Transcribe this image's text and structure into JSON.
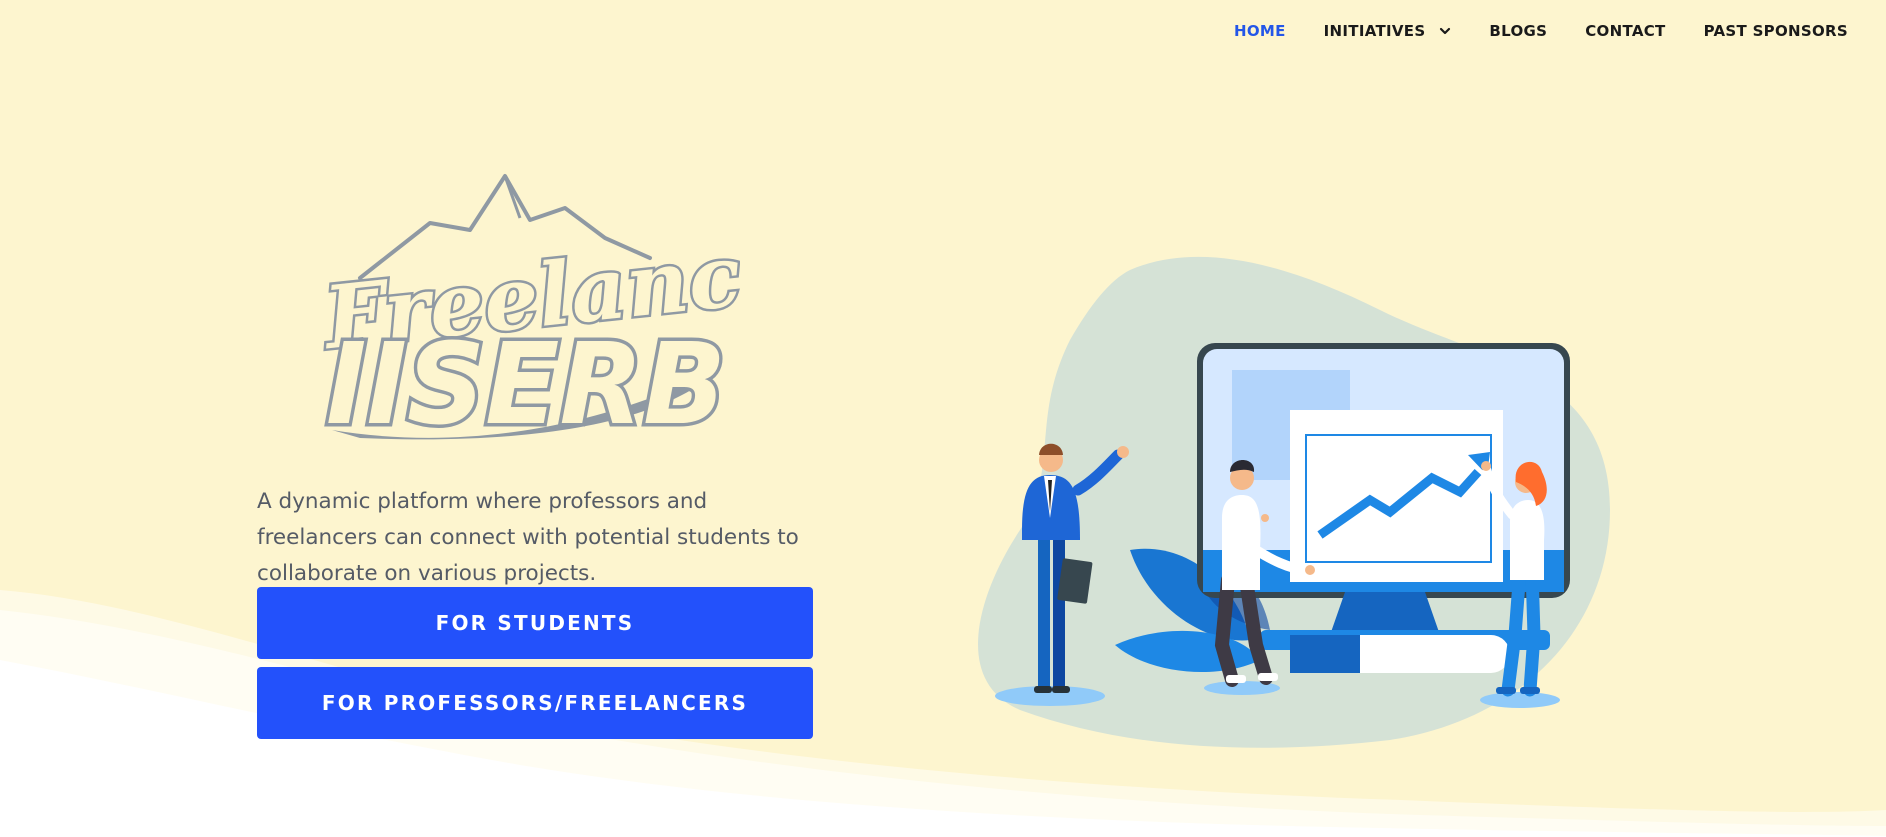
{
  "nav": {
    "items": [
      {
        "label": "HOME",
        "active": true
      },
      {
        "label": "INITIATIVES",
        "has_dropdown": true
      },
      {
        "label": "BLOGS"
      },
      {
        "label": "CONTACT"
      },
      {
        "label": "PAST SPONSORS"
      }
    ]
  },
  "hero": {
    "logo": {
      "line1": "Freelance",
      "line2": "IISERB"
    },
    "tagline": "A dynamic platform where professors and freelancers can connect with potential students to collaborate on various projects.",
    "buttons": {
      "students_label": "FOR STUDENTS",
      "professors_label": "FOR PROFESSORS/FREELANCERS"
    }
  },
  "colors": {
    "background": "#fdf5cf",
    "accent": "#2351fb",
    "nav_active": "#2356e8",
    "logo_gray": "#8f99a3",
    "blob": "#d5e2d6"
  },
  "icons": {
    "dropdown": "chevron-down-icon"
  }
}
